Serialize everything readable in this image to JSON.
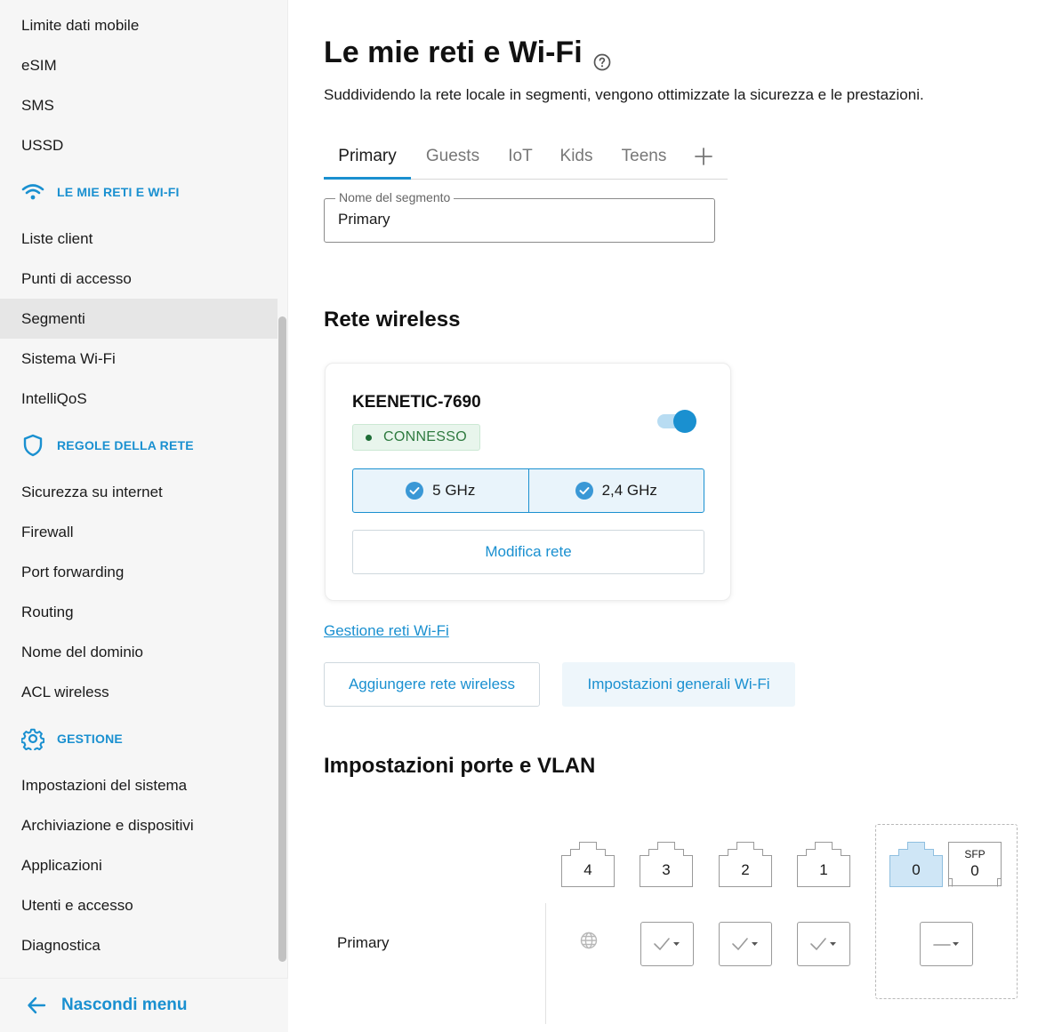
{
  "sidebar": {
    "items_top": [
      "Limite dati mobile",
      "eSIM",
      "SMS",
      "USSD"
    ],
    "section_networks": "LE MIE RETI E WI-FI",
    "items_networks": [
      "Liste client",
      "Punti di accesso",
      "Segmenti",
      "Sistema Wi-Fi",
      "IntelliQoS"
    ],
    "section_rules": "REGOLE DELLA RETE",
    "items_rules": [
      "Sicurezza su internet",
      "Firewall",
      "Port forwarding",
      "Routing",
      "Nome del dominio",
      "ACL wireless"
    ],
    "section_management": "GESTIONE",
    "items_management": [
      "Impostazioni del sistema",
      "Archiviazione e dispositivi",
      "Applicazioni",
      "Utenti e accesso",
      "Diagnostica"
    ],
    "hide_menu_label": "Nascondi menu"
  },
  "page": {
    "title": "Le mie reti e Wi-Fi",
    "subtitle": "Suddividendo la rete locale in segmenti, vengono ottimizzate la sicurezza e le prestazioni."
  },
  "tabs": [
    "Primary",
    "Guests",
    "IoT",
    "Kids",
    "Teens"
  ],
  "segment_name": {
    "label": "Nome del segmento",
    "value": "Primary"
  },
  "wireless": {
    "heading": "Rete wireless",
    "network_name": "KEENETIC-7690",
    "enabled": true,
    "status": "CONNESSO",
    "bands": [
      "5 GHz",
      "2,4 GHz"
    ],
    "edit_button": "Modifica rete",
    "manage_link": "Gestione reti Wi-Fi",
    "add_button": "Aggiungere rete wireless",
    "general_settings_button": "Impostazioni generali Wi-Fi"
  },
  "ports": {
    "heading": "Impostazioni porte e VLAN",
    "lan_ports": [
      "4",
      "3",
      "2",
      "1"
    ],
    "wan_port": "0",
    "sfp_label": "SFP",
    "sfp_port": "0",
    "segment_row": "Primary"
  },
  "colors": {
    "accent": "#1a90d0",
    "status_green": "#2e7a3f",
    "sidebar_bg": "#f6f6f6"
  }
}
